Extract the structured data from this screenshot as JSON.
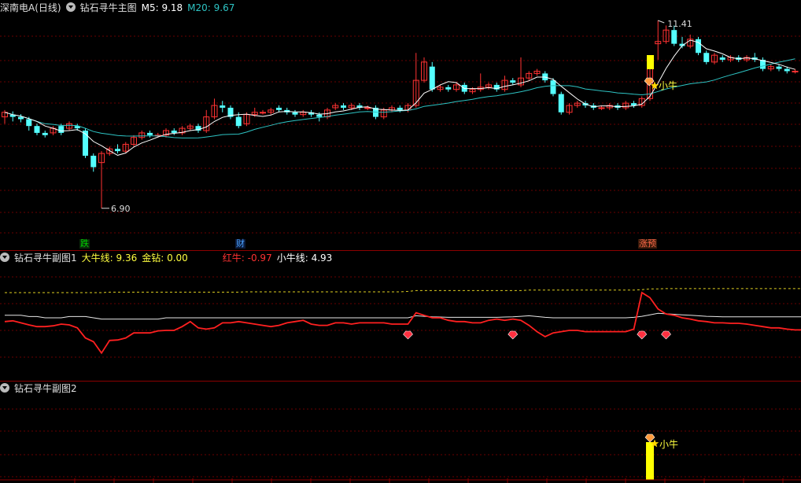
{
  "main_panel": {
    "stock": "深南电A(日线)",
    "indicator": "钻石寻牛主图",
    "m5": "M5: 9.18",
    "m20": "M20: 9.67",
    "high_label": "11.41",
    "low_label": "6.90",
    "signal_label": "小牛",
    "tags": [
      "跌",
      "财",
      "涨预"
    ],
    "colors": {
      "up": "#ff3232",
      "down": "#54ffff",
      "ma5": "#ffffff",
      "ma20": "#2ec4c4",
      "signal_bar": "#ffff00",
      "tag_green": "#00c000",
      "tag_blue": "#4aa0ff",
      "tag_red": "#ff6a4a"
    }
  },
  "sub1": {
    "title": "钻石寻牛副图1",
    "big_bull": "大牛线: 9.36",
    "gold_diamond": "金钻: 0.00",
    "red_bull": "红牛: -0.97",
    "small_bull": "小牛线: 4.93"
  },
  "sub2": {
    "title": "钻石寻牛副图2",
    "signal_label": "小牛"
  },
  "chart_data": {
    "type": "candlestick",
    "price_range": [
      6.9,
      11.41
    ],
    "candles": [
      [
        9.3,
        9.4,
        9.15,
        9.45
      ],
      [
        9.35,
        9.3,
        9.2,
        9.42
      ],
      [
        9.3,
        9.25,
        9.18,
        9.36
      ],
      [
        9.25,
        9.1,
        9.0,
        9.3
      ],
      [
        9.1,
        8.95,
        8.9,
        9.15
      ],
      [
        8.95,
        8.9,
        8.85,
        9.0
      ],
      [
        8.95,
        9.05,
        8.9,
        9.1
      ],
      [
        9.1,
        8.95,
        8.9,
        9.15
      ],
      [
        9.05,
        9.15,
        9.0,
        9.2
      ],
      [
        9.1,
        9.05,
        9.0,
        9.15
      ],
      [
        9.0,
        8.45,
        8.4,
        9.05
      ],
      [
        8.45,
        8.2,
        8.1,
        8.5
      ],
      [
        8.3,
        8.5,
        7.3,
        8.55
      ],
      [
        8.5,
        8.6,
        8.45,
        8.65
      ],
      [
        8.6,
        8.55,
        8.5,
        8.7
      ],
      [
        8.55,
        8.7,
        8.5,
        8.75
      ],
      [
        8.7,
        8.85,
        8.65,
        8.9
      ],
      [
        8.85,
        8.95,
        8.8,
        9.0
      ],
      [
        8.95,
        8.9,
        8.85,
        9.0
      ],
      [
        8.9,
        8.9,
        8.85,
        8.95
      ],
      [
        8.9,
        9.0,
        8.85,
        9.05
      ],
      [
        9.0,
        8.95,
        8.9,
        9.05
      ],
      [
        8.95,
        9.05,
        8.9,
        9.1
      ],
      [
        9.05,
        9.1,
        9.0,
        9.15
      ],
      [
        9.1,
        9.0,
        8.95,
        9.15
      ],
      [
        9.0,
        9.3,
        8.95,
        9.45
      ],
      [
        9.3,
        9.55,
        9.25,
        9.7
      ],
      [
        9.55,
        9.5,
        9.4,
        9.65
      ],
      [
        9.5,
        9.3,
        9.25,
        9.55
      ],
      [
        9.3,
        9.1,
        9.05,
        9.4
      ],
      [
        9.15,
        9.35,
        9.1,
        9.4
      ],
      [
        9.35,
        9.4,
        9.3,
        9.5
      ],
      [
        9.4,
        9.4,
        9.35,
        9.45
      ],
      [
        9.4,
        9.45,
        9.35,
        9.5
      ],
      [
        9.5,
        9.45,
        9.4,
        9.55
      ],
      [
        9.45,
        9.4,
        9.35,
        9.5
      ],
      [
        9.4,
        9.35,
        9.3,
        9.45
      ],
      [
        9.35,
        9.4,
        9.3,
        9.45
      ],
      [
        9.4,
        9.35,
        9.3,
        9.45
      ],
      [
        9.35,
        9.3,
        9.2,
        9.4
      ],
      [
        9.3,
        9.45,
        9.25,
        9.5
      ],
      [
        9.5,
        9.55,
        9.45,
        9.6
      ],
      [
        9.55,
        9.5,
        9.45,
        9.6
      ],
      [
        9.5,
        9.55,
        9.45,
        9.6
      ],
      [
        9.55,
        9.5,
        9.45,
        9.6
      ],
      [
        9.5,
        9.5,
        9.45,
        9.55
      ],
      [
        9.5,
        9.3,
        9.25,
        9.55
      ],
      [
        9.3,
        9.45,
        9.25,
        9.5
      ],
      [
        9.45,
        9.5,
        9.4,
        9.55
      ],
      [
        9.5,
        9.45,
        9.4,
        9.55
      ],
      [
        9.45,
        9.55,
        9.4,
        9.6
      ],
      [
        9.55,
        10.1,
        9.5,
        10.7
      ],
      [
        10.1,
        10.5,
        10.05,
        10.6
      ],
      [
        10.4,
        9.9,
        9.85,
        10.5
      ],
      [
        9.9,
        9.95,
        9.85,
        10.0
      ],
      [
        9.95,
        9.9,
        9.85,
        10.0
      ],
      [
        9.9,
        10.0,
        9.85,
        10.05
      ],
      [
        10.0,
        9.85,
        9.8,
        10.05
      ],
      [
        9.85,
        9.9,
        9.8,
        9.95
      ],
      [
        9.9,
        9.95,
        9.85,
        10.25
      ],
      [
        9.95,
        10.0,
        9.9,
        10.05
      ],
      [
        10.0,
        9.9,
        9.85,
        10.05
      ],
      [
        9.9,
        10.1,
        9.85,
        10.2
      ],
      [
        10.1,
        10.05,
        10.0,
        10.15
      ],
      [
        10.0,
        10.15,
        9.95,
        10.6
      ],
      [
        10.15,
        10.25,
        10.1,
        10.3
      ],
      [
        10.25,
        10.3,
        10.2,
        10.35
      ],
      [
        10.25,
        10.1,
        10.05,
        10.3
      ],
      [
        10.1,
        9.8,
        9.75,
        10.15
      ],
      [
        9.8,
        9.4,
        9.35,
        9.85
      ],
      [
        9.4,
        9.55,
        9.35,
        9.6
      ],
      [
        9.55,
        9.6,
        9.5,
        9.65
      ],
      [
        9.6,
        9.55,
        9.5,
        9.65
      ],
      [
        9.55,
        9.5,
        9.45,
        9.6
      ],
      [
        9.5,
        9.5,
        9.45,
        9.55
      ],
      [
        9.5,
        9.55,
        9.45,
        9.6
      ],
      [
        9.55,
        9.5,
        9.45,
        9.6
      ],
      [
        9.5,
        9.6,
        9.45,
        9.65
      ],
      [
        9.6,
        9.55,
        9.5,
        9.65
      ],
      [
        9.55,
        9.7,
        9.5,
        9.75
      ],
      [
        9.7,
        10.4,
        9.65,
        10.45
      ],
      [
        10.9,
        10.95,
        10.55,
        11.41
      ],
      [
        10.95,
        11.2,
        10.9,
        11.3
      ],
      [
        11.2,
        10.9,
        10.85,
        11.3
      ],
      [
        10.9,
        10.85,
        10.8,
        11.05
      ],
      [
        10.85,
        11.0,
        10.8,
        11.1
      ],
      [
        11.0,
        10.7,
        10.65,
        11.05
      ],
      [
        10.7,
        10.5,
        10.45,
        10.75
      ],
      [
        10.5,
        10.65,
        10.45,
        10.7
      ],
      [
        10.6,
        10.55,
        10.5,
        10.65
      ],
      [
        10.55,
        10.6,
        10.5,
        10.65
      ],
      [
        10.6,
        10.55,
        10.5,
        10.65
      ],
      [
        10.55,
        10.6,
        10.5,
        10.65
      ],
      [
        10.6,
        10.55,
        10.5,
        10.7
      ],
      [
        10.55,
        10.35,
        10.3,
        10.6
      ],
      [
        10.35,
        10.4,
        10.3,
        10.45
      ],
      [
        10.4,
        10.35,
        10.3,
        10.45
      ],
      [
        10.35,
        10.3,
        10.25,
        10.4
      ],
      [
        10.3,
        10.3,
        10.25,
        10.35
      ]
    ],
    "sub1_series": {
      "small_bull": [
        0.6,
        0.6,
        0.6,
        0.55,
        0.55,
        0.5,
        0.5,
        0.5,
        0.55,
        0.55,
        0.55,
        0.5,
        0.45,
        0.45,
        0.45,
        0.45,
        0.45,
        0.45,
        0.45,
        0.45,
        0.5,
        0.5,
        0.5,
        0.5,
        0.5,
        0.5,
        0.5,
        0.5,
        0.5,
        0.5,
        0.5,
        0.5,
        0.5,
        0.5,
        0.5,
        0.5,
        0.5,
        0.5,
        0.5,
        0.5,
        0.5,
        0.5,
        0.5,
        0.5,
        0.5,
        0.5,
        0.5,
        0.5,
        0.5,
        0.5,
        0.5,
        0.58,
        0.56,
        0.54,
        0.53,
        0.52,
        0.52,
        0.52,
        0.52,
        0.52,
        0.52,
        0.52,
        0.53,
        0.54,
        0.56,
        0.58,
        0.55,
        0.52,
        0.5,
        0.5,
        0.5,
        0.5,
        0.5,
        0.5,
        0.5,
        0.5,
        0.5,
        0.5,
        0.52,
        0.56,
        0.62,
        0.68,
        0.66,
        0.64,
        0.62,
        0.6,
        0.58,
        0.56,
        0.55,
        0.54,
        0.54,
        0.54,
        0.54,
        0.54,
        0.54,
        0.54,
        0.54,
        0.54,
        0.54,
        0.54
      ],
      "red_bull": [
        0.35,
        0.38,
        0.3,
        0.22,
        0.15,
        0.15,
        0.18,
        0.25,
        0.22,
        0.1,
        -0.3,
        -0.45,
        -0.9,
        -0.4,
        -0.38,
        -0.3,
        -0.1,
        -0.1,
        -0.1,
        -0.02,
        0.0,
        0.0,
        0.15,
        0.35,
        0.1,
        0.05,
        0.1,
        0.3,
        0.3,
        0.35,
        0.3,
        0.25,
        0.2,
        0.15,
        0.2,
        0.3,
        0.35,
        0.4,
        0.25,
        0.2,
        0.2,
        0.3,
        0.3,
        0.25,
        0.3,
        0.3,
        0.3,
        0.3,
        0.25,
        0.25,
        0.25,
        0.7,
        0.6,
        0.5,
        0.5,
        0.4,
        0.35,
        0.35,
        0.3,
        0.3,
        0.4,
        0.45,
        0.4,
        0.45,
        0.4,
        0.2,
        -0.05,
        -0.25,
        -0.1,
        -0.05,
        0.0,
        0.0,
        -0.05,
        -0.05,
        -0.05,
        -0.05,
        -0.05,
        -0.05,
        0.05,
        1.5,
        1.3,
        0.85,
        0.65,
        0.6,
        0.5,
        0.45,
        0.38,
        0.35,
        0.3,
        0.3,
        0.28,
        0.28,
        0.25,
        0.2,
        0.15,
        0.1,
        0.1,
        0.05,
        0.02,
        0.02
      ],
      "big_bull": [
        1.5,
        1.5,
        1.5,
        1.5,
        1.5,
        1.5,
        1.5,
        1.5,
        1.5,
        1.5,
        1.5,
        1.5,
        1.5,
        1.52,
        1.52,
        1.52,
        1.52,
        1.52,
        1.52,
        1.52,
        1.52,
        1.52,
        1.52,
        1.52,
        1.52,
        1.52,
        1.52,
        1.52,
        1.52,
        1.52,
        1.53,
        1.53,
        1.53,
        1.53,
        1.53,
        1.53,
        1.53,
        1.53,
        1.53,
        1.53,
        1.53,
        1.53,
        1.53,
        1.53,
        1.53,
        1.53,
        1.53,
        1.53,
        1.53,
        1.53,
        1.55,
        1.58,
        1.58,
        1.58,
        1.58,
        1.58,
        1.58,
        1.58,
        1.58,
        1.58,
        1.58,
        1.58,
        1.58,
        1.58,
        1.58,
        1.6,
        1.6,
        1.6,
        1.6,
        1.6,
        1.6,
        1.6,
        1.6,
        1.6,
        1.6,
        1.6,
        1.6,
        1.6,
        1.6,
        1.62,
        1.65,
        1.65,
        1.66,
        1.66,
        1.66,
        1.66,
        1.66,
        1.66,
        1.66,
        1.66,
        1.66,
        1.66,
        1.66,
        1.66,
        1.66,
        1.66,
        1.66,
        1.66,
        1.66,
        1.66
      ]
    }
  }
}
